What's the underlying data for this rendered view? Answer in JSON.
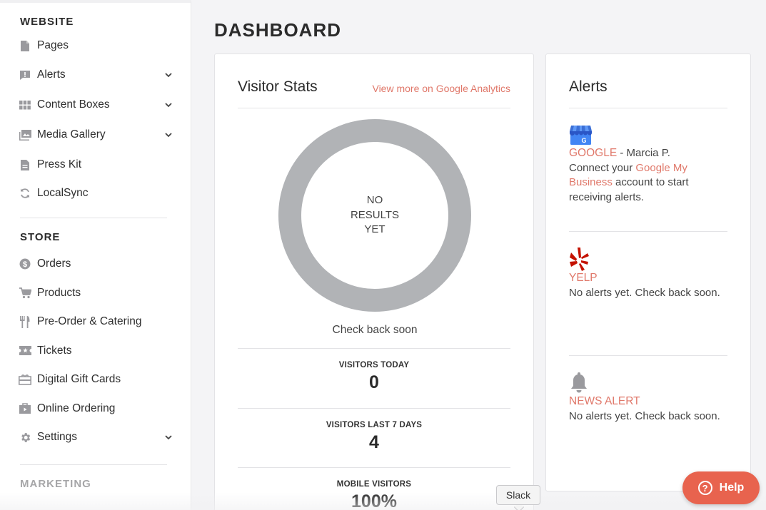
{
  "sidebar": {
    "website_title": "WEBSITE",
    "website_items": [
      {
        "label": "Pages"
      },
      {
        "label": "Alerts"
      },
      {
        "label": "Content Boxes"
      },
      {
        "label": "Media Gallery"
      },
      {
        "label": "Press Kit"
      },
      {
        "label": "LocalSync"
      }
    ],
    "store_title": "STORE",
    "store_items": [
      {
        "label": "Orders"
      },
      {
        "label": "Products"
      },
      {
        "label": "Pre-Order & Catering"
      },
      {
        "label": "Tickets"
      },
      {
        "label": "Digital Gift Cards"
      },
      {
        "label": "Online Ordering"
      },
      {
        "label": "Settings"
      }
    ],
    "marketing_title": "MARKETING"
  },
  "page_title": "DASHBOARD",
  "visitor_stats": {
    "title": "Visitor Stats",
    "ga_link": "View more on Google Analytics",
    "donut_lines": [
      "NO",
      "RESULTS",
      "YET"
    ],
    "check_back": "Check back soon",
    "stats": [
      {
        "label": "VISITORS TODAY",
        "value": "0"
      },
      {
        "label": "VISITORS LAST 7 DAYS",
        "value": "4"
      },
      {
        "label": "MOBILE VISITORS",
        "value": "100%"
      }
    ]
  },
  "alerts": {
    "title": "Alerts",
    "google": {
      "source": "GOOGLE",
      "suffix": " - Marcia P.",
      "text_before": "Connect your ",
      "link": "Google My Business",
      "text_after": " account to start receiving alerts."
    },
    "yelp": {
      "source": "YELP",
      "message": "No alerts yet. Check back soon."
    },
    "news": {
      "source": "NEWS ALERT",
      "message": "No alerts yet. Check back soon."
    }
  },
  "help_button": {
    "label": "Help"
  },
  "tooltip": {
    "label": "Slack"
  },
  "colors": {
    "accent": "#e0786a",
    "help": "#e8634e",
    "donut": "#b1b3b6"
  }
}
